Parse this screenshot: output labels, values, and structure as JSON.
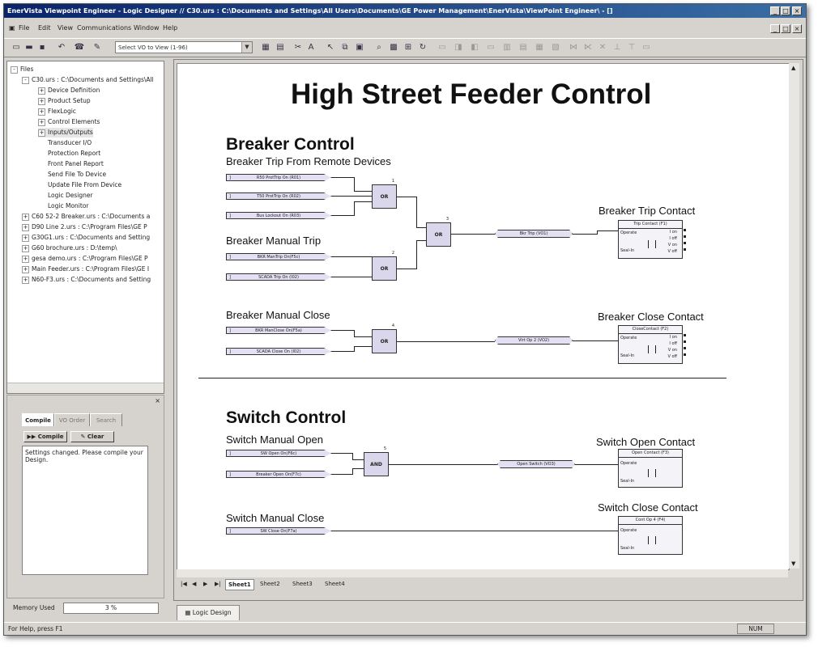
{
  "window": {
    "title": "EnerVista Viewpoint Engineer - Logic Designer // C30.urs : C:\\Documents and Settings\\All Users\\Documents\\GE Power Management\\EnerVista\\ViewPoint Engineer\\ - []"
  },
  "menubar": [
    "File",
    "Edit",
    "View",
    "Communications",
    "Window",
    "Help"
  ],
  "toolbar": {
    "vo_select": "Select VO to View (1-96)"
  },
  "file_tree": {
    "root": "Files",
    "items": [
      {
        "label": "C30.urs : C:\\Documents and Settings\\All",
        "level": 1,
        "exp": "-"
      },
      {
        "label": "Device Definition",
        "level": 2,
        "exp": "+"
      },
      {
        "label": "Product Setup",
        "level": 2,
        "exp": "+"
      },
      {
        "label": "FlexLogic",
        "level": 2,
        "exp": "+"
      },
      {
        "label": "Control Elements",
        "level": 2,
        "exp": "+"
      },
      {
        "label": "Inputs/Outputs",
        "level": 2,
        "exp": "+"
      },
      {
        "label": "Transducer I/O",
        "level": 2,
        "exp": ""
      },
      {
        "label": "Protection Report",
        "level": 2,
        "exp": ""
      },
      {
        "label": "Front Panel Report",
        "level": 2,
        "exp": ""
      },
      {
        "label": "Send File To Device",
        "level": 2,
        "exp": ""
      },
      {
        "label": "Update File From Device",
        "level": 2,
        "exp": ""
      },
      {
        "label": "Logic Designer",
        "level": 2,
        "exp": ""
      },
      {
        "label": "Logic Monitor",
        "level": 2,
        "exp": ""
      },
      {
        "label": "C60 52-2 Breaker.urs : C:\\Documents a",
        "level": 1,
        "exp": "+"
      },
      {
        "label": "D90 Line 2.urs : C:\\Program Files\\GE P",
        "level": 1,
        "exp": "+"
      },
      {
        "label": "G30G1.urs : C:\\Documents and Setting",
        "level": 1,
        "exp": "+"
      },
      {
        "label": "G60 brochure.urs : D:\\temp\\",
        "level": 1,
        "exp": "+"
      },
      {
        "label": "gesa demo.urs : C:\\Program Files\\GE P",
        "level": 1,
        "exp": "+"
      },
      {
        "label": "Main Feeder.urs : C:\\Program Files\\GE I",
        "level": 1,
        "exp": "+"
      },
      {
        "label": "N60-F3.urs : C:\\Documents and Setting",
        "level": 1,
        "exp": "+"
      }
    ]
  },
  "compile_panel": {
    "tabs": [
      "Compile",
      "VO Order",
      "Search"
    ],
    "compile_btn": "Compile",
    "clear_btn": "Clear",
    "message": "Settings changed. Please compile your Design."
  },
  "memory": {
    "label": "Memory Used",
    "value": "3 %"
  },
  "diagram": {
    "title": "High Street Feeder Control",
    "breaker_section": "Breaker Control",
    "switch_section": "Switch Control",
    "groups": {
      "trip_remote": "Breaker Trip From Remote Devices",
      "manual_trip": "Breaker Manual Trip",
      "manual_close": "Breaker Manual Close",
      "sw_open": "Switch Manual Open",
      "sw_close": "Switch Manual Close",
      "trip_contact": "Breaker Trip Contact",
      "close_contact": "Breaker Close Contact",
      "open_contact": "Switch Open Contact",
      "swclose_contact": "Switch Close Contact"
    },
    "inputs": {
      "i1": "R50 ProtTrip On (R01)",
      "i2": "T50 ProtTrip On (R02)",
      "i3": "Bus Lockout On (R03)",
      "i4": "BKR ManTrip On(F5c)",
      "i5": "SCADA Trip On (I02)",
      "i6": "BKR ManClose On(F5a)",
      "i7": "SCADA Close On (I02)",
      "i8": "SW Open On(F6c)",
      "i9": "Breaker Open On(F7c)",
      "i10": "SW Close On(F7a)"
    },
    "gates": {
      "g1": "OR",
      "g2": "OR",
      "g3": "OR",
      "g4": "OR",
      "g5": "AND"
    },
    "vos": {
      "v1": "Bkr Trip (VO1)",
      "v2": "Virt Op 2 (VO2)",
      "v3": "Open Switch (VO3)"
    },
    "contacts": {
      "c1": {
        "title": "Trip Contact (F1)",
        "rows": [
          "I on",
          "I off",
          "V on",
          "V off"
        ]
      },
      "c2": {
        "title": "CloseContact (F2)",
        "rows": [
          "I on",
          "I off",
          "V on",
          "V off"
        ]
      },
      "c3": {
        "title": "Open Contact (F3)"
      },
      "c4": {
        "title": "Cont Op 4 (F4)"
      },
      "operate": "Operate",
      "seal_in": "Seal-In"
    }
  },
  "sheets": [
    "Sheet1",
    "Sheet2",
    "Sheet3",
    "Sheet4"
  ],
  "doc_tab": "Logic Design",
  "status": {
    "text": "For Help, press F1",
    "num": "NUM"
  }
}
